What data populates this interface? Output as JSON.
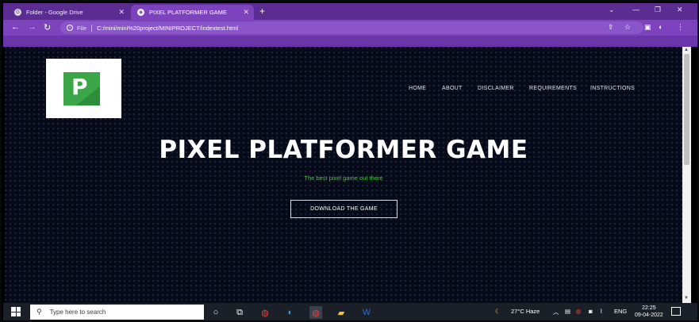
{
  "browser": {
    "tabs": [
      {
        "label": "Folder - Google Drive",
        "icon": "google-drive-icon"
      },
      {
        "label": "PIXEL PLATFORMER GAME",
        "icon": "globe-icon"
      }
    ],
    "address": {
      "scheme_label": "File",
      "url": "C:/mini/mini%20project/MINIPROJECT/indextest.html"
    },
    "accent": "#7c43bd"
  },
  "site": {
    "logo_letter": "P",
    "nav": [
      "HOME",
      "ABOUT",
      "DISCLAIMER",
      "REQUIREMENTS",
      "INSTRUCTIONS"
    ],
    "title": "PIXEL PLATFORMER GAME",
    "tagline": "The best pixel game out there",
    "cta": "DOWNLOAD THE GAME",
    "tagline_color": "#3ec93e"
  },
  "taskbar": {
    "search_placeholder": "Type here to search",
    "weather": "27°C  Haze",
    "language": "ENG",
    "time": "22:25",
    "date": "09-04-2022"
  }
}
